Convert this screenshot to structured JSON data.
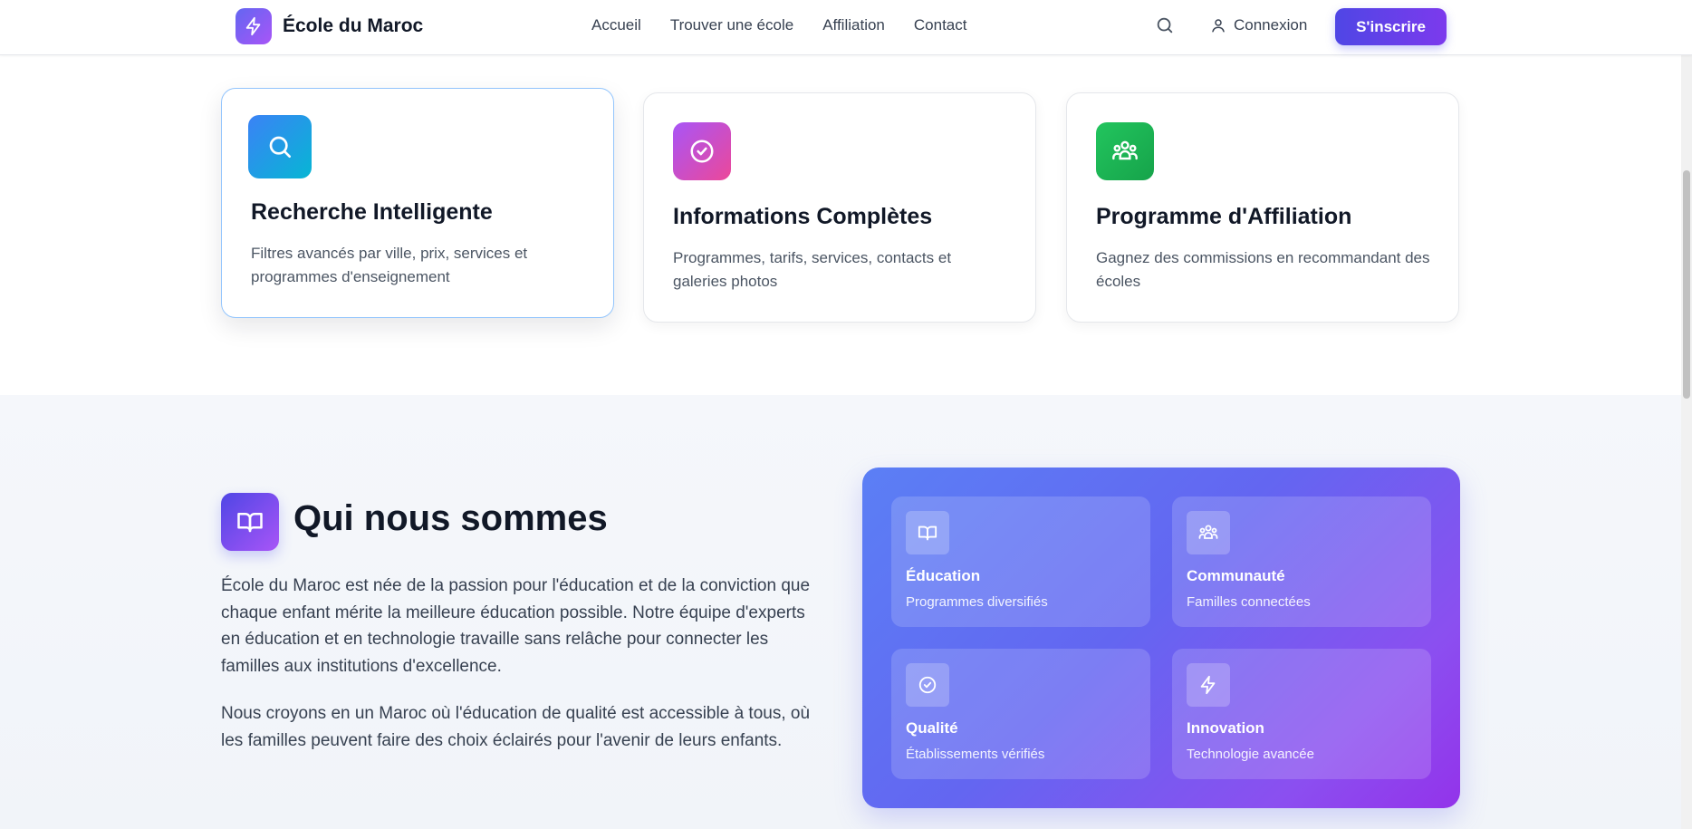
{
  "header": {
    "brand": "École du Maroc",
    "brand_icon": "lightning-icon",
    "nav": [
      "Accueil",
      "Trouver une école",
      "Affiliation",
      "Contact"
    ],
    "search_icon": "search-icon",
    "login_label": "Connexion",
    "signup_label": "S'inscrire"
  },
  "features": [
    {
      "title": "Recherche Intelligente",
      "description": "Filtres avancés par ville, prix, services et programmes d'enseignement",
      "icon": "search-icon",
      "color": "#3b82f6"
    },
    {
      "title": "Informations Complètes",
      "description": "Programmes, tarifs, services, contacts et galeries photos",
      "icon": "check-circle-icon",
      "color": "#a855f7"
    },
    {
      "title": "Programme d'Affiliation",
      "description": "Gagnez des commissions en recommandant des écoles",
      "icon": "users-icon",
      "color": "#22c55e"
    }
  ],
  "about": {
    "icon": "book-icon",
    "title": "Qui nous sommes",
    "paragraph_1": "École du Maroc est née de la passion pour l'éducation et de la conviction que chaque enfant mérite la meilleure éducation possible. Notre équipe d'experts en éducation et en technologie travaille sans relâche pour connecter les familles aux institutions d'excellence.",
    "paragraph_2": "Nous croyons en un Maroc où l'éducation de qualité est accessible à tous, où les familles peuvent faire des choix éclairés pour l'avenir de leurs enfants.",
    "tiles": [
      {
        "title": "Éducation",
        "subtitle": "Programmes diversifiés",
        "icon": "book-icon"
      },
      {
        "title": "Communauté",
        "subtitle": "Familles connectées",
        "icon": "users-icon"
      },
      {
        "title": "Qualité",
        "subtitle": "Établissements vérifiés",
        "icon": "check-circle-icon"
      },
      {
        "title": "Innovation",
        "subtitle": "Technologie avancée",
        "icon": "lightning-icon"
      }
    ]
  },
  "colors": {
    "primary": "#4f46e5",
    "accent": "#7c3aed",
    "text": "#111827"
  }
}
